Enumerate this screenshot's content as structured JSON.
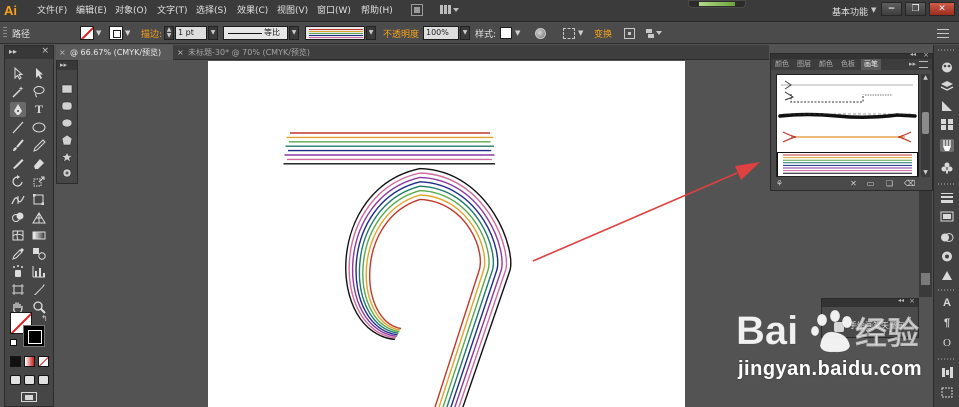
{
  "app": {
    "logo": "Ai"
  },
  "menubar": {
    "items": [
      {
        "id": "file",
        "label": "文件(F)"
      },
      {
        "id": "edit",
        "label": "编辑(E)"
      },
      {
        "id": "object",
        "label": "对象(O)"
      },
      {
        "id": "type",
        "label": "文字(T)"
      },
      {
        "id": "select",
        "label": "选择(S)"
      },
      {
        "id": "effect",
        "label": "效果(C)"
      },
      {
        "id": "view",
        "label": "视图(V)"
      },
      {
        "id": "window",
        "label": "窗口(W)"
      },
      {
        "id": "help",
        "label": "帮助(H)"
      }
    ],
    "workspace": "基本功能",
    "window_buttons": {
      "minimize": "−",
      "restore": "❐",
      "close": "✕"
    }
  },
  "controlbar": {
    "object_type": "路径",
    "stroke_label": "描边:",
    "stroke_weight": "1 pt",
    "profile_label": "等比",
    "opacity_label": "不透明度",
    "opacity_value": "100%",
    "style_label": "样式:",
    "transform_label": "变换"
  },
  "tabs": [
    {
      "label": "@ 66.67% (CMYK/预览)",
      "active": true
    },
    {
      "label": "未标题-30* @ 70% (CMYK/预览)",
      "active": false
    }
  ],
  "brush_panel": {
    "tabs": [
      "颜色",
      "图层",
      "颜色",
      "色板",
      "画笔"
    ],
    "active_tab": "画笔",
    "rows": [
      {
        "kind": "thin-arrow"
      },
      {
        "kind": "dashed-decorative"
      },
      {
        "kind": "charcoal"
      },
      {
        "kind": "orange-arrow"
      },
      {
        "kind": "rainbow-pattern",
        "selected": true
      }
    ]
  },
  "symbols_panel": {
    "label": "手绘画笔矢量包"
  },
  "brush_stripe_colors": [
    "#c0392b",
    "#e2a32e",
    "#5aa94a",
    "#1f7a6e",
    "#1d2c88",
    "#8a3aa0",
    "#d06aa0",
    "#111111"
  ],
  "watermark": {
    "brand_text": "Bai  经验",
    "url": "jingyan.baidu.com"
  },
  "colors": {
    "accent_orange": "#f7a21b",
    "annotation_red": "#e04040",
    "ui_dark": "#3b3b3b",
    "canvas_gray": "#535353"
  }
}
